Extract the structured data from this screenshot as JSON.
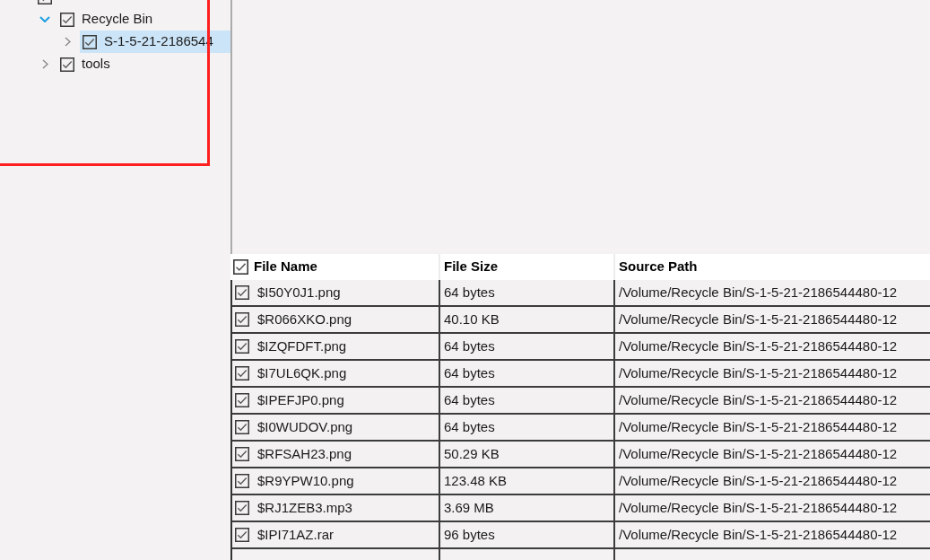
{
  "tree": [
    {
      "checked": true,
      "children": [
        {
          "label": "Recycle Bin",
          "checked": true,
          "expanded": true,
          "selected": false,
          "children": [
            {
              "label": "S-1-5-21-2186544",
              "checked": true,
              "expanded": false,
              "selected": true
            }
          ]
        },
        {
          "label": "tools",
          "checked": true,
          "expanded": false,
          "selected": false
        }
      ]
    }
  ],
  "annotations": [
    {
      "kind": "rectangle"
    }
  ],
  "table": {
    "header_checked": true,
    "columns": [
      "File Name",
      "File Size",
      "Source Path"
    ],
    "rows": [
      {
        "checked": true,
        "cells": [
          "$I50Y0J1.png",
          "64 bytes",
          "/Volume/Recycle Bin/S-1-5-21-2186544480-12"
        ]
      },
      {
        "checked": true,
        "cells": [
          "$R066XKO.png",
          "40.10 KB",
          "/Volume/Recycle Bin/S-1-5-21-2186544480-12"
        ]
      },
      {
        "checked": true,
        "cells": [
          "$IZQFDFT.png",
          "64 bytes",
          "/Volume/Recycle Bin/S-1-5-21-2186544480-12"
        ]
      },
      {
        "checked": true,
        "cells": [
          "$I7UL6QK.png",
          "64 bytes",
          "/Volume/Recycle Bin/S-1-5-21-2186544480-12"
        ]
      },
      {
        "checked": true,
        "cells": [
          "$IPEFJP0.png",
          "64 bytes",
          "/Volume/Recycle Bin/S-1-5-21-2186544480-12"
        ]
      },
      {
        "checked": true,
        "cells": [
          "$I0WUDOV.png",
          "64 bytes",
          "/Volume/Recycle Bin/S-1-5-21-2186544480-12"
        ]
      },
      {
        "checked": true,
        "cells": [
          "$RFSAH23.png",
          "50.29 KB",
          "/Volume/Recycle Bin/S-1-5-21-2186544480-12"
        ]
      },
      {
        "checked": true,
        "cells": [
          "$R9YPW10.png",
          "123.48 KB",
          "/Volume/Recycle Bin/S-1-5-21-2186544480-12"
        ]
      },
      {
        "checked": true,
        "cells": [
          "$RJ1ZEB3.mp3",
          "3.69 MB",
          "/Volume/Recycle Bin/S-1-5-21-2186544480-12"
        ]
      },
      {
        "checked": true,
        "cells": [
          "$IPI71AZ.rar",
          "96 bytes",
          "/Volume/Recycle Bin/S-1-5-21-2186544480-12"
        ]
      }
    ]
  }
}
